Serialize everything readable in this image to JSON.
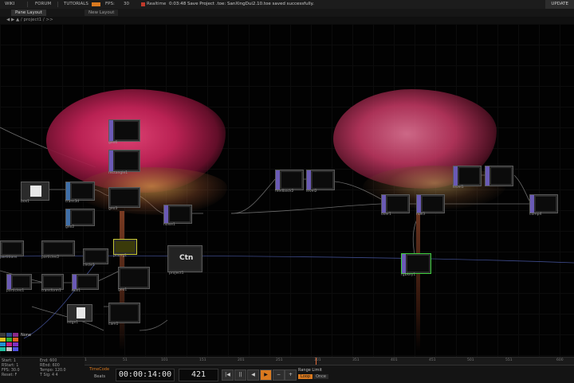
{
  "topbar": {
    "wiki": "WIKI",
    "forum": "FORUM",
    "tutorials": "TUTORIALS",
    "fps_label": "FPS:",
    "fps_value": "30",
    "realtime": "Realtime",
    "status": "0:03:48 Save Project .toe: SanXingDui2.10.toe saved successfully.",
    "update": "UPDATE"
  },
  "tabs": [
    "Pane Layout",
    "New Layout"
  ],
  "path": "◀  ▶  ▲  / project1 /  >>",
  "nodes": [
    "geo6",
    "rectangle1",
    "geo3",
    "box1",
    "trans3d",
    "geo2",
    "noise1",
    "feedback2",
    "level2",
    "over1",
    "null3",
    "level1",
    "comp4",
    "rgbkey1",
    "project1",
    "phong1",
    "circle1",
    "partitions",
    "particles2",
    "particlesgpu1",
    "geo1",
    "transform1",
    "particles1",
    "null1",
    "edge1",
    "cam1",
    "render1"
  ],
  "ctn_label": "Ctn",
  "bottom": {
    "stats": {
      "start": "Start: 1",
      "end": "End: 600",
      "rstart": "RStart: 1",
      "rend": "REnd: 600",
      "fps": "FPS: 30.0",
      "tempo": "Tempo: 120.0",
      "reset": "Reset: F",
      "tsig": "T Sig: 4   4"
    },
    "timecode_label": "TimeCode",
    "beats_label": "Beats",
    "timecode": "00:00:14:00",
    "frame": "421",
    "range_limit": "Range Limit",
    "loop": "Loop",
    "once": "Once",
    "ruler": [
      "1",
      "51",
      "101",
      "151",
      "201",
      "251",
      "301",
      "351",
      "401",
      "451",
      "501",
      "551",
      "600"
    ]
  },
  "palette_label": "None",
  "colors": {
    "accent": "#d9791f",
    "node_flag": "#6a5ab5",
    "rose": "#e2386e",
    "selected_node": "#3ecf3e"
  }
}
